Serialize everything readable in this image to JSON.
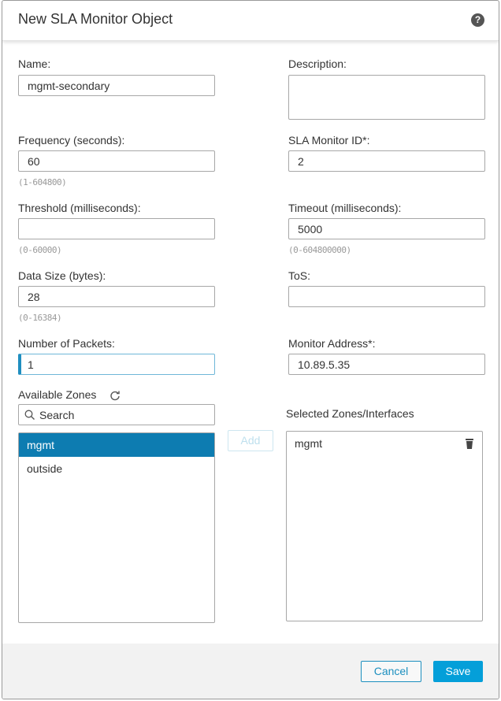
{
  "dialog": {
    "title": "New SLA Monitor Object",
    "help_icon": "?"
  },
  "fields": {
    "name": {
      "label": "Name:",
      "value": "mgmt-secondary"
    },
    "description": {
      "label": "Description:",
      "value": ""
    },
    "frequency": {
      "label": "Frequency (seconds):",
      "value": "60",
      "hint": "(1-604800)"
    },
    "sla_monitor_id": {
      "label": "SLA Monitor ID*:",
      "value": "2"
    },
    "threshold": {
      "label": "Threshold (milliseconds):",
      "value": "",
      "hint": "(0-60000)"
    },
    "timeout": {
      "label": "Timeout (milliseconds):",
      "value": "5000",
      "hint": "(0-604800000)"
    },
    "data_size": {
      "label": "Data Size (bytes):",
      "value": "28",
      "hint": "(0-16384)"
    },
    "tos": {
      "label": "ToS:",
      "value": ""
    },
    "num_packets": {
      "label": "Number of Packets:",
      "value": "1"
    },
    "monitor_address": {
      "label": "Monitor Address*:",
      "value": "10.89.5.35"
    }
  },
  "zones": {
    "available_label": "Available Zones",
    "search_placeholder": "Search",
    "available": [
      {
        "label": "mgmt",
        "selected": true
      },
      {
        "label": "outside",
        "selected": false
      }
    ],
    "add_label": "Add",
    "selected_label": "Selected Zones/Interfaces",
    "selected": [
      {
        "label": "mgmt"
      }
    ]
  },
  "footer": {
    "cancel_label": "Cancel",
    "save_label": "Save"
  },
  "colors": {
    "accent": "#049fd9",
    "selection": "#0d7cb1"
  }
}
